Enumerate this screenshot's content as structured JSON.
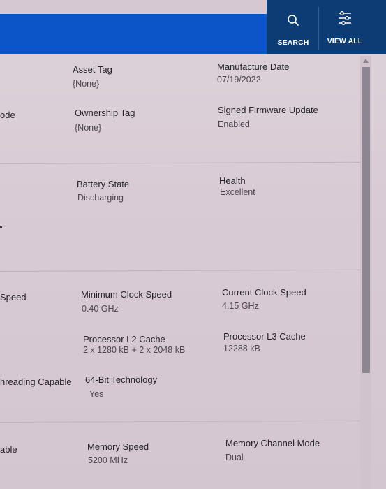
{
  "toolbar": {
    "search_label": "SEARCH",
    "view_all_label": "VIEW ALL",
    "search_icon": "search-icon",
    "view_all_icon": "filter-settings-icon"
  },
  "colors": {
    "header_blue": "#0b55c9",
    "header_dark": "#0d3b74",
    "background": "#d9cdd6"
  },
  "system": {
    "asset_tag": {
      "label": "Asset Tag",
      "value": "{None}"
    },
    "manufacture_date": {
      "label": "Manufacture Date",
      "value": "07/19/2022"
    },
    "cut_label": "ode",
    "ownership_tag": {
      "label": "Ownership Tag",
      "value": "{None}"
    },
    "signed_firmware_update": {
      "label": "Signed Firmware Update",
      "value": "Enabled"
    }
  },
  "battery": {
    "battery_state": {
      "label": "Battery State",
      "value": "Discharging"
    },
    "health": {
      "label": "Health",
      "value": "Excellent"
    }
  },
  "processor": {
    "cut_label_1": "Speed",
    "minimum_clock_speed": {
      "label": "Minimum Clock Speed",
      "value": "0.40 GHz"
    },
    "current_clock_speed": {
      "label": "Current Clock Speed",
      "value": "4.15 GHz"
    },
    "l2_cache": {
      "label": "Processor L2 Cache",
      "value": "2 x 1280  kB + 2 x 2048  kB"
    },
    "l3_cache": {
      "label": "Processor L3 Cache",
      "value": "12288 kB"
    },
    "cut_label_2": "hreading Capable",
    "sixty_four_bit": {
      "label": "64-Bit Technology",
      "value": "Yes"
    }
  },
  "memory": {
    "cut_label": "able",
    "memory_speed": {
      "label": "Memory Speed",
      "value": "5200 MHz"
    },
    "memory_channel_mode": {
      "label": "Memory Channel Mode",
      "value": "Dual"
    }
  }
}
